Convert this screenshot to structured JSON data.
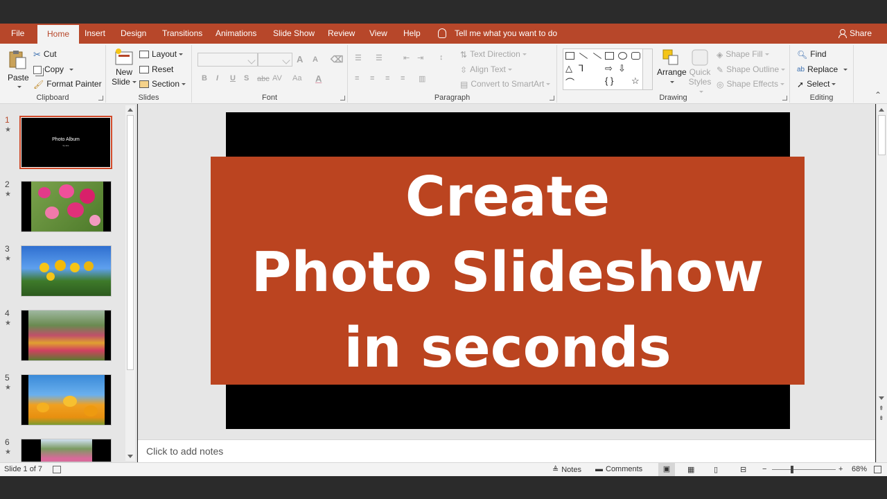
{
  "menu": {
    "file": "File",
    "tabs": [
      "Home",
      "Insert",
      "Design",
      "Transitions",
      "Animations",
      "Slide Show",
      "Review",
      "View",
      "Help"
    ],
    "tell_me": "Tell me what you want to do",
    "share": "Share"
  },
  "ribbon": {
    "clipboard": {
      "label": "Clipboard",
      "paste": "Paste",
      "cut": "Cut",
      "copy": "Copy",
      "format_painter": "Format Painter"
    },
    "slides": {
      "label": "Slides",
      "new_slide_1": "New",
      "new_slide_2": "Slide",
      "layout": "Layout",
      "reset": "Reset",
      "section": "Section"
    },
    "font": {
      "label": "Font",
      "bold": "B",
      "italic": "I",
      "underline": "U",
      "shadow": "S",
      "strike": "abc",
      "spacing": "AV",
      "case": "Aa"
    },
    "paragraph": {
      "label": "Paragraph",
      "text_direction": "Text Direction",
      "align_text": "Align Text",
      "smartart": "Convert to SmartArt"
    },
    "drawing": {
      "label": "Drawing",
      "arrange": "Arrange",
      "quick_1": "Quick",
      "quick_2": "Styles",
      "shape_fill": "Shape Fill",
      "shape_outline": "Shape Outline",
      "shape_effects": "Shape Effects"
    },
    "editing": {
      "label": "Editing",
      "find": "Find",
      "replace": "Replace",
      "select": "Select"
    }
  },
  "thumbnails": [
    {
      "num": "1",
      "star": "★",
      "title": "Photo Album",
      "sub": "by ace"
    },
    {
      "num": "2",
      "star": "★"
    },
    {
      "num": "3",
      "star": "★"
    },
    {
      "num": "4",
      "star": "★"
    },
    {
      "num": "5",
      "star": "★"
    },
    {
      "num": "6",
      "star": "★"
    }
  ],
  "overlay": {
    "line1": "Create",
    "line2": "Photo Slideshow",
    "line3": "in seconds"
  },
  "notes_placeholder": "Click to add notes",
  "status": {
    "slide": "Slide 1 of 7",
    "notes": "Notes",
    "comments": "Comments",
    "zoom": "68%"
  },
  "colors": {
    "accent": "#b7472a",
    "banner": "#bb4420"
  }
}
